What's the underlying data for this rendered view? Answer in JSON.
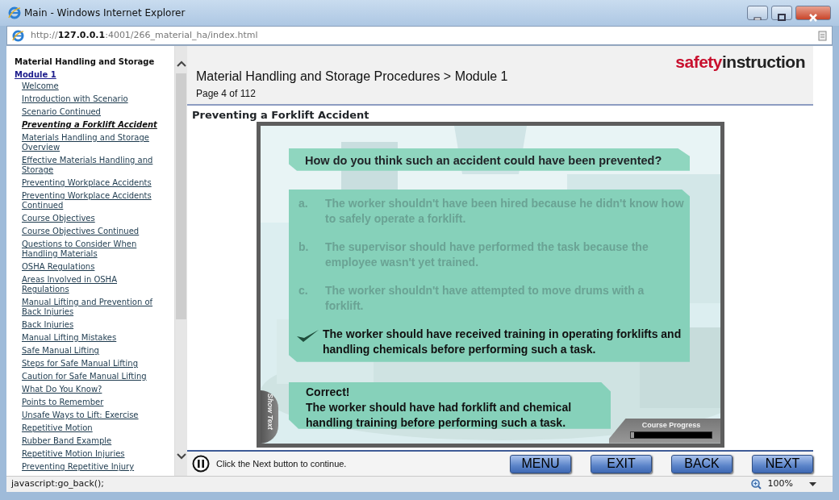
{
  "window": {
    "title": "Main - Windows Internet Explorer"
  },
  "address_bar": {
    "url": "http://**127.0.0.1**:4001/266_material_ha/index.html"
  },
  "sidebar": {
    "course_title": "Material Handling and Storage",
    "module": "Module 1",
    "items": [
      {
        "label": "Welcome",
        "selected": false
      },
      {
        "label": "Introduction with Scenario",
        "selected": false
      },
      {
        "label": "Scenario Continued",
        "selected": false
      },
      {
        "label": "Preventing a Forklift Accident",
        "selected": true
      },
      {
        "label": "Materials Handling and Storage Overview",
        "selected": false
      },
      {
        "label": "Effective Materials Handling and Storage",
        "selected": false
      },
      {
        "label": "Preventing Workplace Accidents",
        "selected": false
      },
      {
        "label": "Preventing Workplace Accidents Continued",
        "selected": false
      },
      {
        "label": "Course Objectives",
        "selected": false
      },
      {
        "label": "Course Objectives Continued",
        "selected": false
      },
      {
        "label": "Questions to Consider When Handling Materials",
        "selected": false
      },
      {
        "label": "OSHA Regulations",
        "selected": false
      },
      {
        "label": "Areas Involved in OSHA Regulations",
        "selected": false
      },
      {
        "label": "Manual Lifting and Prevention of Back Injuries",
        "selected": false
      },
      {
        "label": "Back Injuries",
        "selected": false
      },
      {
        "label": "Manual Lifting Mistakes",
        "selected": false
      },
      {
        "label": "Safe Manual Lifting",
        "selected": false
      },
      {
        "label": "Steps for Safe Manual Lifting",
        "selected": false
      },
      {
        "label": "Caution for Safe Manual Lifting",
        "selected": false
      },
      {
        "label": "What Do You Know?",
        "selected": false
      },
      {
        "label": "Points to Remember",
        "selected": false
      },
      {
        "label": "Unsafe Ways to Lift: Exercise",
        "selected": false
      },
      {
        "label": "Repetitive Motion",
        "selected": false
      },
      {
        "label": "Rubber Band Example",
        "selected": false
      },
      {
        "label": "Repetitive Motion Injuries",
        "selected": false
      },
      {
        "label": "Preventing Repetitive Injury",
        "selected": false
      }
    ]
  },
  "header": {
    "breadcrumb": "Material Handling and Storage Procedures > Module 1",
    "page": "Page 4 of 112",
    "logo": [
      "safety",
      "instruction"
    ]
  },
  "page_title": "Preventing a Forklift Accident",
  "slide": {
    "question": "How do you think such an accident could have been prevented?",
    "answers": [
      {
        "marker": "a.",
        "text": "The worker shouldn't have been hired because he didn't know how to safely operate a forklift.",
        "selected": false
      },
      {
        "marker": "b.",
        "text": "The supervisor should have performed the task because the employee wasn't yet trained.",
        "selected": false
      },
      {
        "marker": "c.",
        "text": "The worker shouldn't have attempted to move drums with a forklift.",
        "selected": false
      },
      {
        "text": "The worker should have received training in operating forklifts and handling chemicals before performing such a task.",
        "selected": true
      }
    ],
    "feedback": {
      "heading": "Correct!",
      "text": "The worker should have had forklift and chemical handling training before performing such a task."
    },
    "show_text": "Show Text",
    "progress": {
      "label": "Course Progress",
      "level": 0.04
    }
  },
  "footer": {
    "instruction": "Click the Next button to continue.",
    "buttons": [
      "MENU",
      "EXIT",
      "BACK",
      "NEXT"
    ]
  },
  "status_bar": {
    "text": "javascript:go_back();",
    "zoom": "100%"
  }
}
